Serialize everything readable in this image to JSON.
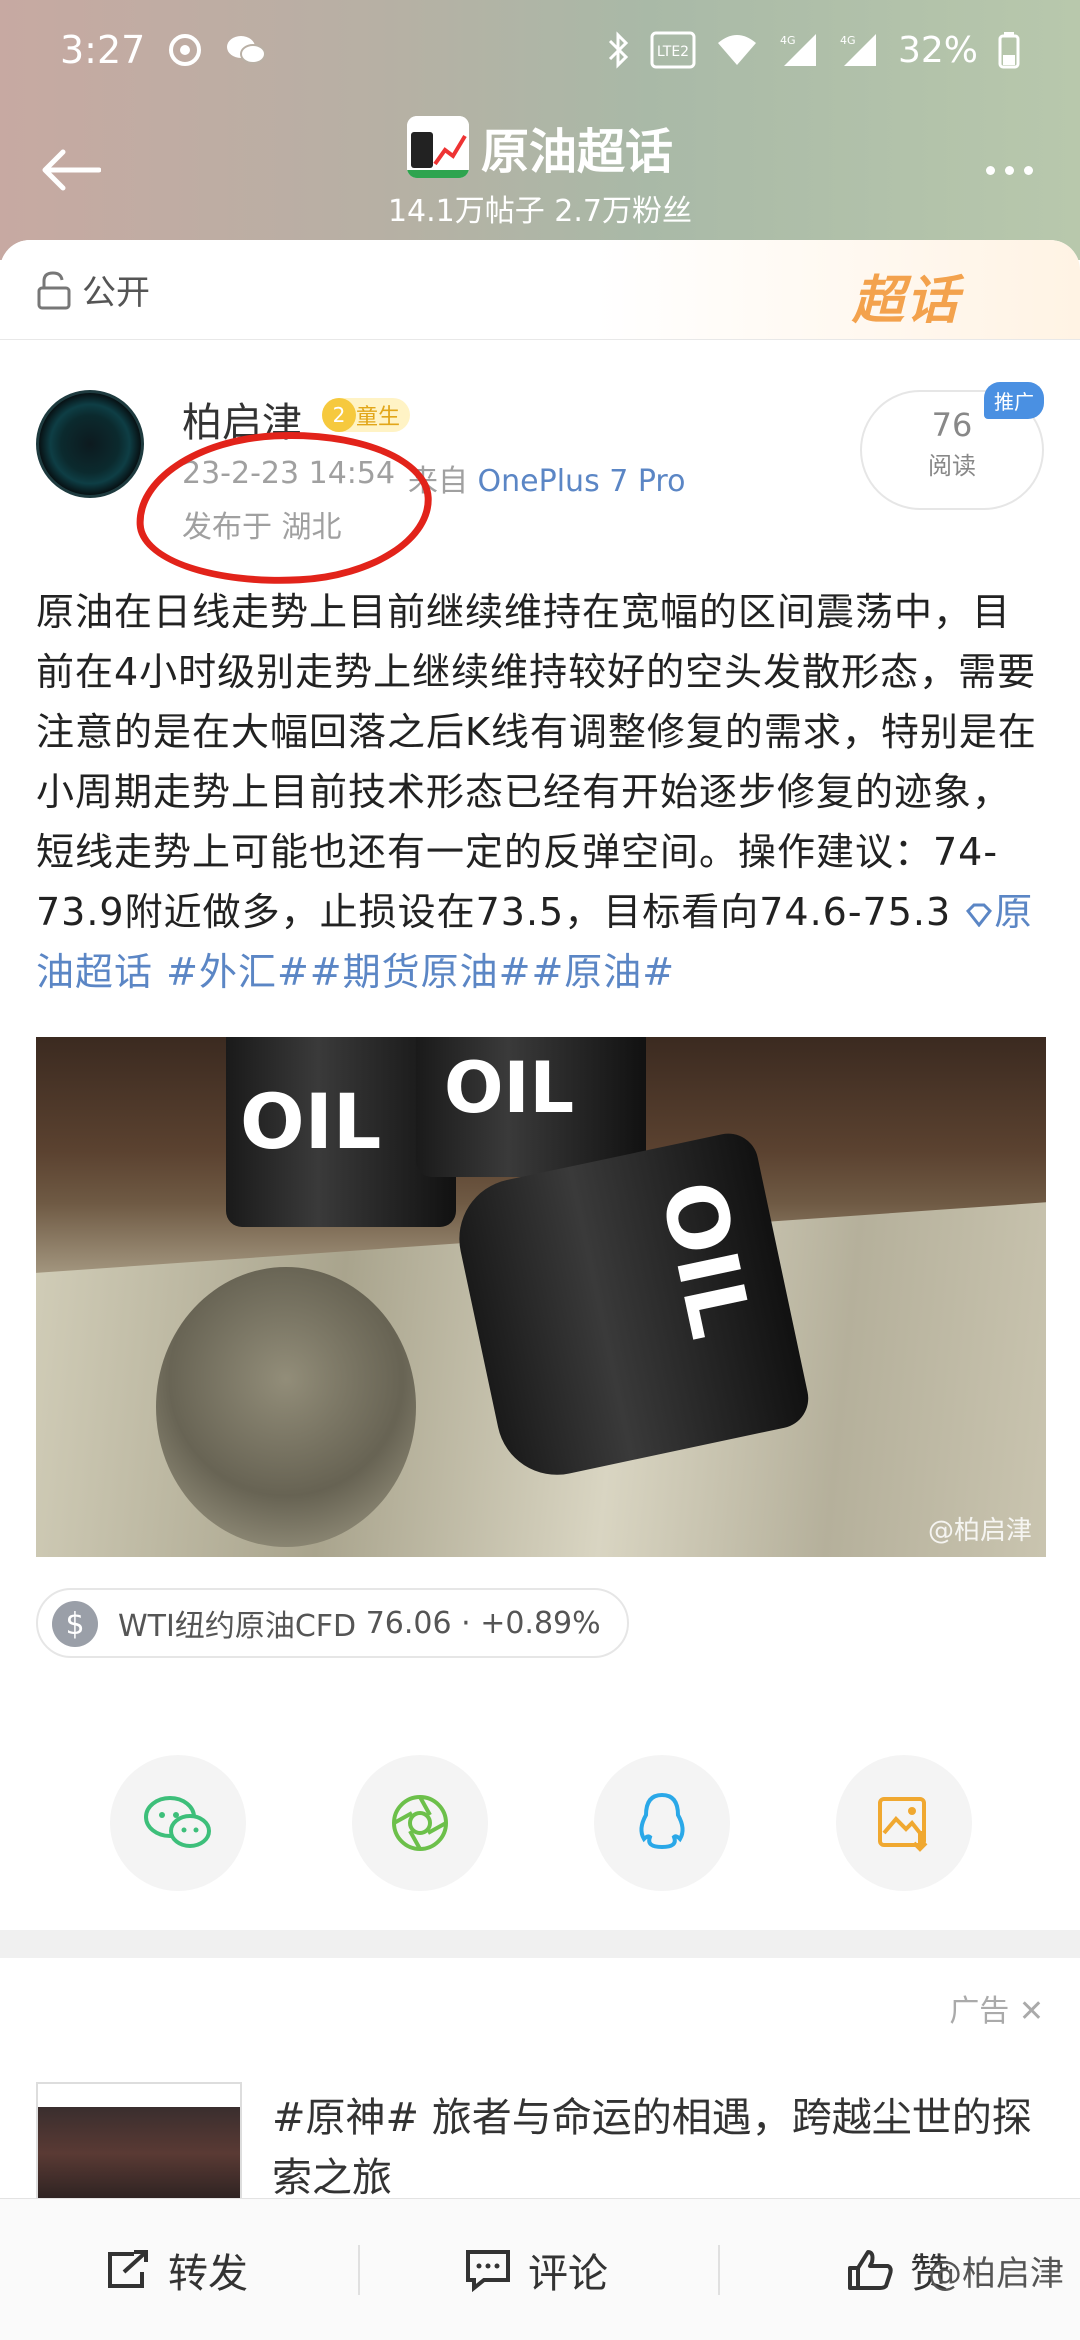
{
  "status_bar": {
    "time": "3:27",
    "battery": "32%",
    "net1": "4G",
    "net2": "4G",
    "volte": "Vo LTE 2"
  },
  "nav": {
    "title": "原油超话",
    "subtitle": "14.1万帖子 2.7万粉丝"
  },
  "public_row": {
    "label": "公开",
    "badge": "超话"
  },
  "post": {
    "author": "柏启津",
    "level": "2",
    "level_label": "童生",
    "time": "23-2-23 14:54",
    "source_prefix": "来自 ",
    "source_device": "OnePlus 7 Pro",
    "location": "发布于 湖北",
    "read_count": "76",
    "read_label": "阅读",
    "promo_tag": "推广",
    "text": "原油在日线走势上目前继续维持在宽幅的区间震荡中，目前在4小时级别走势上继续维持较好的空头发散形态，需要注意的是在大幅回落之后K线有调整修复的需求，特别是在小周期走势上目前技术形态已经有开始逐步修复的迹象，短线走势上可能也还有一定的反弹空间。操作建议：74-73.9附近做多，止损设在73.5，目标看向74.6-75.3",
    "topic_link": "原油超话",
    "hashtags": "#外汇##期货原油##原油#",
    "image_text_1": "OIL",
    "image_text_2": "OIL",
    "image_text_3": "OIL",
    "image_watermark": "@柏启津"
  },
  "quote": {
    "symbol": "$",
    "name": "WTI纽约原油CFD",
    "price": "76.06",
    "change": "· +0.89%"
  },
  "share": {
    "items": [
      "wechat-icon",
      "moments-icon",
      "qq-icon",
      "save-image-icon"
    ]
  },
  "ad": {
    "label": "广告",
    "title": "#原神# 旅者与命运的相遇，跨越尘世的探索之旅"
  },
  "bottom_bar": {
    "repost": "转发",
    "comment": "评论",
    "like": "赞",
    "watermark": "@柏启津"
  },
  "colors": {
    "link_blue": "#5b86c5",
    "annotation_red": "#e2231a",
    "badge_orange": "#f3a24d"
  }
}
